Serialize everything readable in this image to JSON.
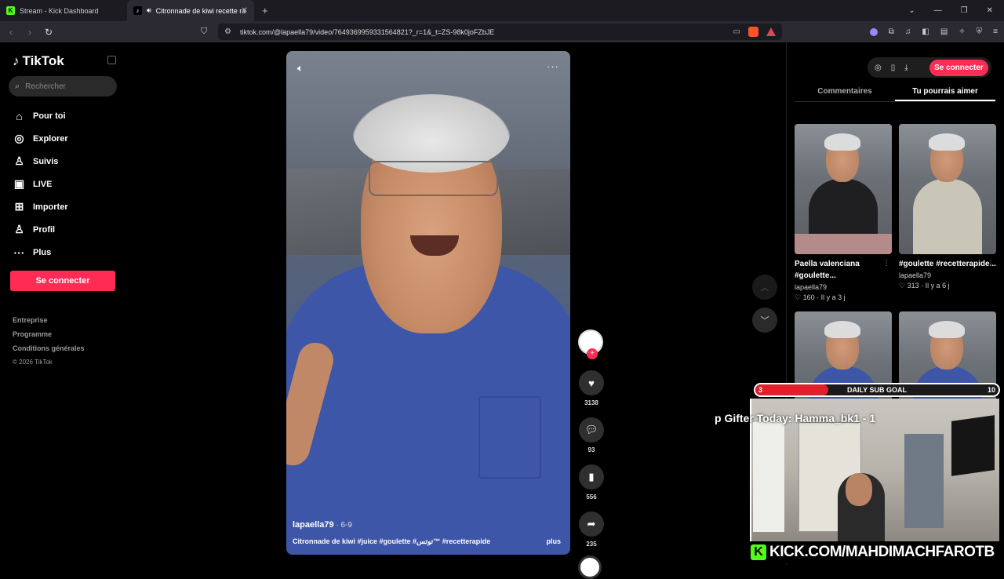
{
  "browser": {
    "tabs": [
      {
        "title": "Stream - Kick Dashboard",
        "active": false
      },
      {
        "title": "Citronnade de kiwi recette ra",
        "active": true
      }
    ],
    "new_tab": "+",
    "url": "tiktok.com/@lapaella79/video/7649369959331564821?_r=1&_t=ZS-98k0joFZbJE"
  },
  "sidebar": {
    "logo": "TikTok",
    "search_placeholder": "Rechercher",
    "nav": [
      {
        "label": "Pour toi",
        "icon": "home-icon",
        "glyph": "⌂"
      },
      {
        "label": "Explorer",
        "icon": "compass-icon",
        "glyph": "◎"
      },
      {
        "label": "Suivis",
        "icon": "following-icon",
        "glyph": "♙"
      },
      {
        "label": "LIVE",
        "icon": "live-icon",
        "glyph": "▣"
      },
      {
        "label": "Importer",
        "icon": "upload-icon",
        "glyph": "⊞"
      },
      {
        "label": "Profil",
        "icon": "profile-icon",
        "glyph": "♙"
      },
      {
        "label": "Plus",
        "icon": "more-icon",
        "glyph": "···"
      }
    ],
    "signin": "Se connecter",
    "footer": [
      "Entreprise",
      "Programme",
      "Conditions générales"
    ],
    "copyright": "© 2026 TikTok"
  },
  "video": {
    "author": "lapaella79",
    "date": " · 6-9",
    "description": "Citronnade de kiwi #juice #goulette #توتس™ #recetterapide",
    "more_link": "plus",
    "likes": "3138",
    "comments": "93",
    "saves": "556",
    "shares": "235"
  },
  "right_panel": {
    "signin": "Se connecter",
    "tabs": [
      "Commentaires",
      "Tu pourrais aimer"
    ],
    "selected_tab": 1,
    "cards": [
      {
        "title": "Paella valenciana #goulette...",
        "user": "lapaella79",
        "likes": "♡ 160",
        "age": "Il y a 3 j",
        "shirt": "#1f1f22"
      },
      {
        "title": "#goulette #recetterapide...",
        "user": "lapaella79",
        "likes": "♡ 313",
        "age": "Il y a 6 j",
        "shirt": "#c9c6b8"
      },
      {
        "title": "",
        "user": "",
        "likes": "",
        "age": "",
        "shirt": "#3d56a8"
      },
      {
        "title": "",
        "user": "",
        "likes": "",
        "age": "",
        "shirt": "#3d56a8"
      }
    ]
  },
  "stream": {
    "goal_label": "DAILY SUB GOAL",
    "goal_current": "3",
    "goal_target": "10",
    "goal_progress": 0.3,
    "ticker": "p Gifter Today: Hamma_bk1 - 1",
    "kick_url": "KICK.COM/MAHDIMACHFAROTB"
  }
}
